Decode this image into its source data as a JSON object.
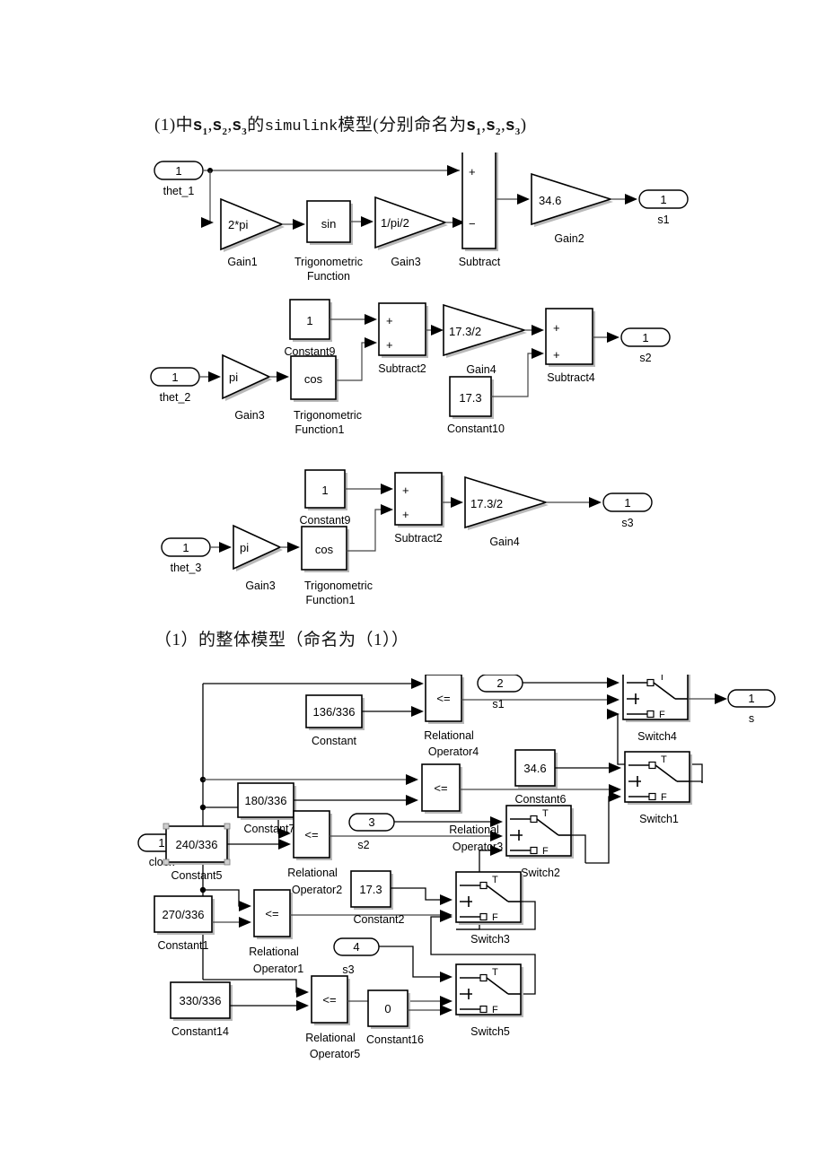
{
  "headings": {
    "h1_pre": "(1)中",
    "h1_mid": "的",
    "h1_sim": "simulink",
    "h1_post": "模型(分别命名为",
    "h1_end": ")",
    "s1": "s",
    "s2": "s",
    "s3": "s",
    "sub1": "1",
    "sub2": "2",
    "sub3": "3",
    "comma": ",",
    "h2": "（1）的整体模型（命名为（1））"
  },
  "diagram1": {
    "name": "s1-model",
    "inport": {
      "num": "1",
      "label": "thet_1"
    },
    "gain1": {
      "value": "2*pi",
      "label": "Gain1"
    },
    "trig": {
      "value": "sin",
      "label1": "Trigonometric",
      "label2": "Function"
    },
    "gain3": {
      "value": "1/pi/2",
      "label": "Gain3"
    },
    "subtract": {
      "label": "Subtract",
      "sign_top": "+",
      "sign_bot": "−"
    },
    "gain2": {
      "value": "34.6",
      "label": "Gain2"
    },
    "outport": {
      "num": "1",
      "label": "s1"
    }
  },
  "diagram2": {
    "name": "s2-model",
    "inport": {
      "num": "1",
      "label": "thet_2"
    },
    "gain3": {
      "value": "pi",
      "label": "Gain3"
    },
    "trig": {
      "value": "cos",
      "label1": "Trigonometric",
      "label2": "Function1"
    },
    "const9": {
      "value": "1",
      "label": "Constant9"
    },
    "subtract2": {
      "label": "Subtract2",
      "sign_top": "+",
      "sign_bot": "+"
    },
    "gain4": {
      "value": "17.3/2",
      "label": "Gain4"
    },
    "const10": {
      "value": "17.3",
      "label": "Constant10"
    },
    "subtract4": {
      "label": "Subtract4",
      "sign_top": "+",
      "sign_bot": "+"
    },
    "outport": {
      "num": "1",
      "label": "s2"
    }
  },
  "diagram3": {
    "name": "s3-model",
    "inport": {
      "num": "1",
      "label": "thet_3"
    },
    "gain3": {
      "value": "pi",
      "label": "Gain3"
    },
    "trig": {
      "value": "cos",
      "label1": "Trigonometric",
      "label2": "Function1"
    },
    "const9": {
      "value": "1",
      "label": "Constant9"
    },
    "subtract2": {
      "label": "Subtract2",
      "sign_top": "+",
      "sign_bot": "+"
    },
    "gain4": {
      "value": "17.3/2",
      "label": "Gain4"
    },
    "outport": {
      "num": "1",
      "label": "s3"
    }
  },
  "diagram4": {
    "name": "overall-model",
    "clock": {
      "num": "1",
      "label": "clock"
    },
    "constants": [
      {
        "value": "136/336",
        "label": "Constant"
      },
      {
        "value": "180/336",
        "label": "Constant7"
      },
      {
        "value": "240/336",
        "label": "Constant5"
      },
      {
        "value": "270/336",
        "label": "Constant1"
      },
      {
        "value": "330/336",
        "label": "Constant14"
      },
      {
        "value": "34.6",
        "label": "Constant6"
      },
      {
        "value": "17.3",
        "label": "Constant2"
      },
      {
        "value": "0",
        "label": "Constant16"
      }
    ],
    "relops": [
      {
        "op": "<=",
        "label1": "Relational",
        "label2": "Operator4"
      },
      {
        "op": "<=",
        "label1": "Relational",
        "label2": "Operator3"
      },
      {
        "op": "<=",
        "label1": "Relational",
        "label2": "Operator2"
      },
      {
        "op": "<=",
        "label1": "Relational",
        "label2": "Operator1"
      },
      {
        "op": "<=",
        "label1": "Relational",
        "label2": "Operator5"
      }
    ],
    "switches": [
      {
        "label": "Switch4",
        "t": "T",
        "f": "F"
      },
      {
        "label": "Switch1",
        "t": "T",
        "f": "F"
      },
      {
        "label": "Switch2",
        "t": "T",
        "f": "F"
      },
      {
        "label": "Switch3",
        "t": "T",
        "f": "F"
      },
      {
        "label": "Switch5",
        "t": "T",
        "f": "F"
      }
    ],
    "signal_inports": [
      {
        "num": "2",
        "label": "s1"
      },
      {
        "num": "3",
        "label": "s2"
      },
      {
        "num": "4",
        "label": "s3"
      }
    ],
    "outport": {
      "num": "1",
      "label": "s"
    }
  },
  "colors": {
    "line": "#444444",
    "stroke": "#000000",
    "bg": "#ffffff",
    "shadow": "#b9b9b9"
  }
}
